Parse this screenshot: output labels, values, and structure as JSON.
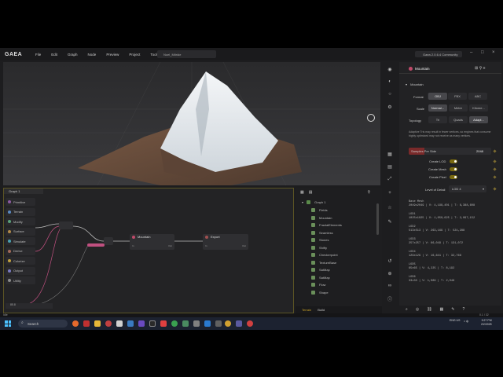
{
  "app": {
    "logo": "GAEA",
    "menus": [
      "File",
      "Edit",
      "Graph",
      "Node",
      "Preview",
      "Project",
      "Tools",
      "Help"
    ],
    "file_name": "Noel_Mitride",
    "version": "Gaea 2.0.6.4 Community"
  },
  "graph": {
    "tab_label": "Graph 1",
    "palette": [
      "Primitive",
      "Terrain",
      "Modify",
      "Surface",
      "Simulate",
      "Derive",
      "Colorize",
      "Output",
      "Utility"
    ],
    "palette_colors": [
      "#8c5aa0",
      "#5a8ac0",
      "#5aa07a",
      "#b08a4a",
      "#4aa0b0",
      "#a06a5a",
      "#c0a040",
      "#7a7ac0",
      "#8a8a8a"
    ],
    "nodes": [
      {
        "label": "Mountain",
        "color": "#c04a6a",
        "port_in": "In",
        "port_out": "Out"
      },
      {
        "label": "Export",
        "color": "#a05050",
        "port_in": "In",
        "port_out": "Out"
      }
    ],
    "zoom_text": "85.8"
  },
  "nodelist": {
    "root": "Graph 1",
    "items": [
      "Fields",
      "Mountain",
      "FractalElements",
      "Seamless",
      "Stones",
      "Shifty",
      "Checkerpoint",
      "TextureBase",
      "SatMap",
      "SatMap",
      "Flow",
      "Shape"
    ],
    "tabs": [
      "Terrain",
      "Build"
    ]
  },
  "props": {
    "node_title": "Mountain",
    "section": "Mountain",
    "fields": {
      "format_label": "Format",
      "format_options": [
        "OBJ",
        "FBX",
        "ABC"
      ],
      "scale_label": "Scale",
      "scale_options": [
        "Normal...",
        "Meter",
        "Kilome..."
      ],
      "topology_label": "Topology",
      "topology_options": [
        "Tri",
        "Quads",
        "Adapt..."
      ],
      "help_text": "Adaptive Tris may result in fewer vertices, so engines that consume highly optimized may not receive as many vertices.",
      "samples_label": "Samples Per Side",
      "samples_value": "2048",
      "toggles": [
        "Create LOD",
        "Create Mesh",
        "Create Pixel"
      ],
      "lod_label": "Level of Detail",
      "lod_value": "LOD 4"
    },
    "lods": [
      {
        "name": "Base Mesh",
        "value": "2049x2049 | V: 4,198,401 | T: 8,388,608"
      },
      {
        "name": "LOD1",
        "value": "1025x1025 | V: 1,050,625 | T: 2,097,152"
      },
      {
        "name": "LOD2",
        "value": "513x513 | V: 263,169 | T: 524,288"
      },
      {
        "name": "LOD3",
        "value": "257x257 | V: 66,049 | T: 131,072"
      },
      {
        "name": "LOD4",
        "value": "129x129 | V: 16,641 | T: 32,768"
      },
      {
        "name": "LOD5",
        "value": "65x65 | V: 4,225 | T: 8,192"
      },
      {
        "name": "LOD6",
        "value": "33x33 | V: 1,089 | T: 2,048"
      }
    ]
  },
  "status": {
    "left": "Idle",
    "right": "0.1 / 32"
  },
  "taskbar": {
    "search_placeholder": "Search",
    "lang": "ENG US",
    "time": "9:27 PM",
    "date": "2/2/2025"
  },
  "colors": {
    "accent": "#c9a227",
    "graph_border": "#5b5424",
    "mountain_node": "#c04a6a"
  }
}
